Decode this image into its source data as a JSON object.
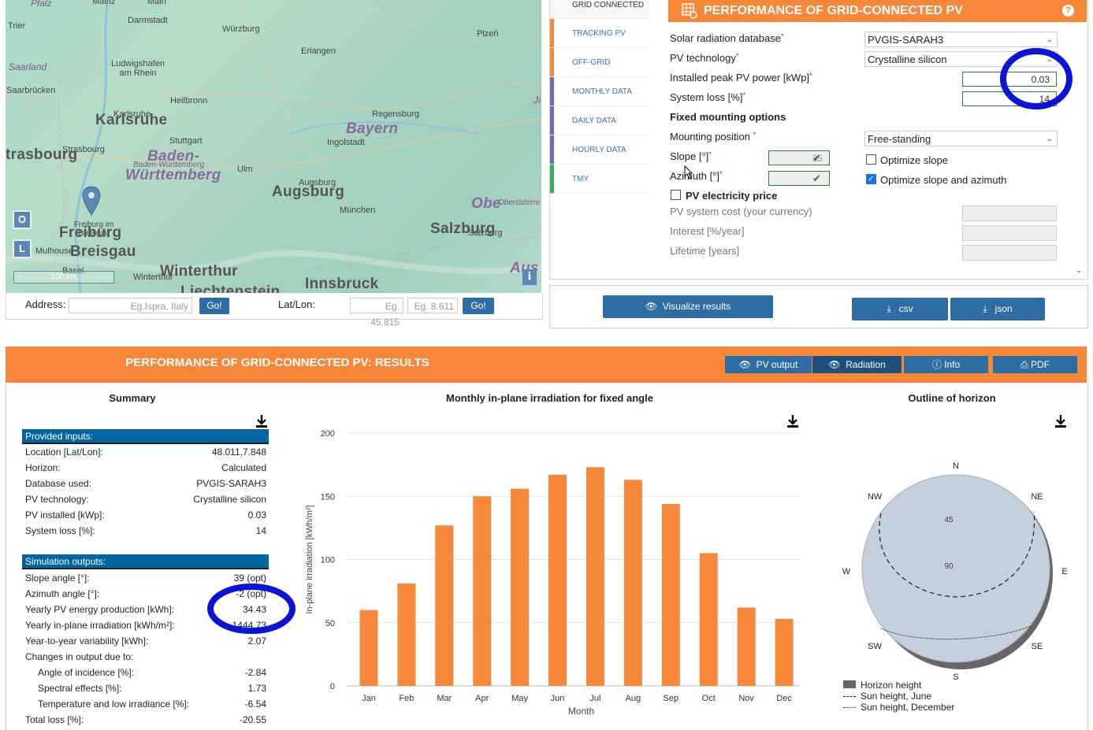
{
  "map": {
    "labels": {
      "pfalz": "Pfalz",
      "mainz": "Mainz",
      "main": "Main",
      "darmstadt": "Darmstadt",
      "trier": "Trier",
      "wurzburg": "Würzburg",
      "plzen": "Plzeň",
      "erlangen": "Erlangen",
      "saarland": "Saarland",
      "ludwigshafen": "Ludwigshafen am Rhein",
      "saarbrucken": "Saarbrücken",
      "karlsruhe_small": "Karlsruhe",
      "karlsruhe": "Karlsruhe",
      "heilbronn": "Heilbronn",
      "regensburg": "Regensburg",
      "bayern": "Bayern",
      "strasbourg_small": "Strasbourg",
      "strasbourg": "trasbourg",
      "stuttgart": "Stuttgart",
      "ingolstadt": "Ingolstadt",
      "baden_small": "Baden-Württemberg",
      "baden": "Baden-",
      "wurttemberg": "Württemberg",
      "ulm": "Ulm",
      "augsburg_small": "Augsburg",
      "augsburg": "Augsburg",
      "munchen": "München",
      "oberosterreich": "Oberösterre",
      "ober": "Obe",
      "freiburg_small": "Freiburg im Breisgau",
      "freiburg": "Freiburg",
      "breisgau": "Breisgau",
      "mulhouse": "Mulhouse",
      "basel": "Basel",
      "salzburg_small": "Salzburg",
      "salzburg": "Salzburg",
      "winterthur_small": "Winterthur",
      "winterthur": "Winterthur",
      "innsbruck": "Innsbruck",
      "liechtenstein": "Liechtenstein",
      "aus": "Aus",
      "ji": "Ji"
    },
    "btn_o": "O",
    "btn_l": "L",
    "scale": "100 km",
    "info": "i"
  },
  "address_bar": {
    "address_label": "Address:",
    "address_placeholder": "Eg.Ispra, Italy",
    "go1": "Go!",
    "latlon_label": "Lat/Lon:",
    "lat_placeholder": "Eg. 45.815",
    "lon_placeholder": "Eg. 8.611",
    "go2": "Go!"
  },
  "tabs": [
    {
      "label": "GRID CONNECTED",
      "color": "#f78839"
    },
    {
      "label": "TRACKING PV",
      "color": "#f78839"
    },
    {
      "label": "OFF-GRID",
      "color": "#f78839"
    },
    {
      "label": "MONTHLY DATA",
      "color": "#7b68b0"
    },
    {
      "label": "DAILY DATA",
      "color": "#7b68b0"
    },
    {
      "label": "HOURLY DATA",
      "color": "#7b68b0"
    },
    {
      "label": "TMY",
      "color": "#3cae5a"
    }
  ],
  "tool": {
    "title": "PERFORMANCE OF GRID-CONNECTED PV",
    "help": "?",
    "db_label": "Solar radiation database",
    "db_value": "PVGIS-SARAH3",
    "tech_label": "PV technology",
    "tech_value": "Crystalline silicon",
    "peak_label": "Installed peak PV power [kWp]",
    "peak_value": "0.03",
    "loss_label": "System loss [%]",
    "loss_value": "14",
    "fixed_heading": "Fixed mounting options",
    "mount_label": "Mounting position",
    "mount_value": "Free-standing",
    "slope_label": "Slope [°]",
    "slope_value": "35",
    "azimuth_label": "Azimuth [°]",
    "optimize_slope": "Optimize slope",
    "optimize_both": "Optimize slope and azimuth",
    "price_label": "PV electricity price",
    "cost_label": "PV system cost (your currency)",
    "interest_label": "Interest [%/year]",
    "lifetime_label": "Lifetime [years]",
    "req": "*"
  },
  "actions": {
    "visualize": "Visualize results",
    "csv": "csv",
    "json": "json"
  },
  "results": {
    "title": "PERFORMANCE OF GRID-CONNECTED PV: RESULTS",
    "pv_output": "PV output",
    "radiation": "Radiation",
    "info": "Info",
    "pdf": "PDF",
    "summary_title": "Summary",
    "provided_inputs": "Provided inputs:",
    "inputs": [
      {
        "k": "Location [Lat/Lon]:",
        "v": "48.011,7.848"
      },
      {
        "k": "Horizon:",
        "v": "Calculated"
      },
      {
        "k": "Database used:",
        "v": "PVGIS-SARAH3"
      },
      {
        "k": "PV technology:",
        "v": "Crystalline silicon"
      },
      {
        "k": "PV installed [kWp]:",
        "v": "0.03"
      },
      {
        "k": "System loss [%]:",
        "v": "14"
      }
    ],
    "simulation_outputs": "Simulation outputs:",
    "outputs": [
      {
        "k": "Slope angle [°]:",
        "v": "39 (opt)"
      },
      {
        "k": "Azimuth angle [°]:",
        "v": "-2 (opt)"
      },
      {
        "k": "Yearly PV energy production [kWh]:",
        "v": "34.43"
      },
      {
        "k": "Yearly in-plane irradiation [kWh/m²]:",
        "v": "1444.73"
      },
      {
        "k": "Year-to-year variability [kWh]:",
        "v": "2.07"
      },
      {
        "k": "Changes in output due to:",
        "v": ""
      },
      {
        "k": "Angle of incidence [%]:",
        "v": "-2.84",
        "indent": true
      },
      {
        "k": "Spectral effects [%]:",
        "v": "1.73",
        "indent": true
      },
      {
        "k": "Temperature and low irradiance [%]:",
        "v": "-6.54",
        "indent": true
      },
      {
        "k": "Total loss [%]:",
        "v": "-20.55"
      }
    ],
    "horizon_title": "Outline of horizon",
    "horizon": {
      "n": "N",
      "ne": "NE",
      "e": "E",
      "se": "SE",
      "s": "S",
      "sw": "SW",
      "w": "W",
      "nw": "NW",
      "r45": "45",
      "r90": "90",
      "legend_height": "Horizon height",
      "legend_june": "Sun height, June",
      "legend_dec": "Sun height, December"
    }
  },
  "chart_data": {
    "type": "bar",
    "title": "Monthly in-plane irradiation for fixed angle",
    "xlabel": "Month",
    "ylabel": "In-plane irradiation [kWh/m²]",
    "categories": [
      "Jan",
      "Feb",
      "Mar",
      "Apr",
      "May",
      "Jun",
      "Jul",
      "Aug",
      "Sep",
      "Oct",
      "Nov",
      "Dec"
    ],
    "values": [
      60,
      81,
      127,
      150,
      156,
      167,
      173,
      163,
      144,
      105,
      62,
      53
    ],
    "ylim": [
      0,
      200
    ],
    "yticks": [
      0,
      50,
      100,
      150,
      200
    ],
    "color": "#f78839",
    "grid": true
  },
  "colors": {
    "accent": "#f78839",
    "button": "#2e6da4",
    "header_blue": "#0066a2",
    "annotation": "#0a14d8"
  }
}
